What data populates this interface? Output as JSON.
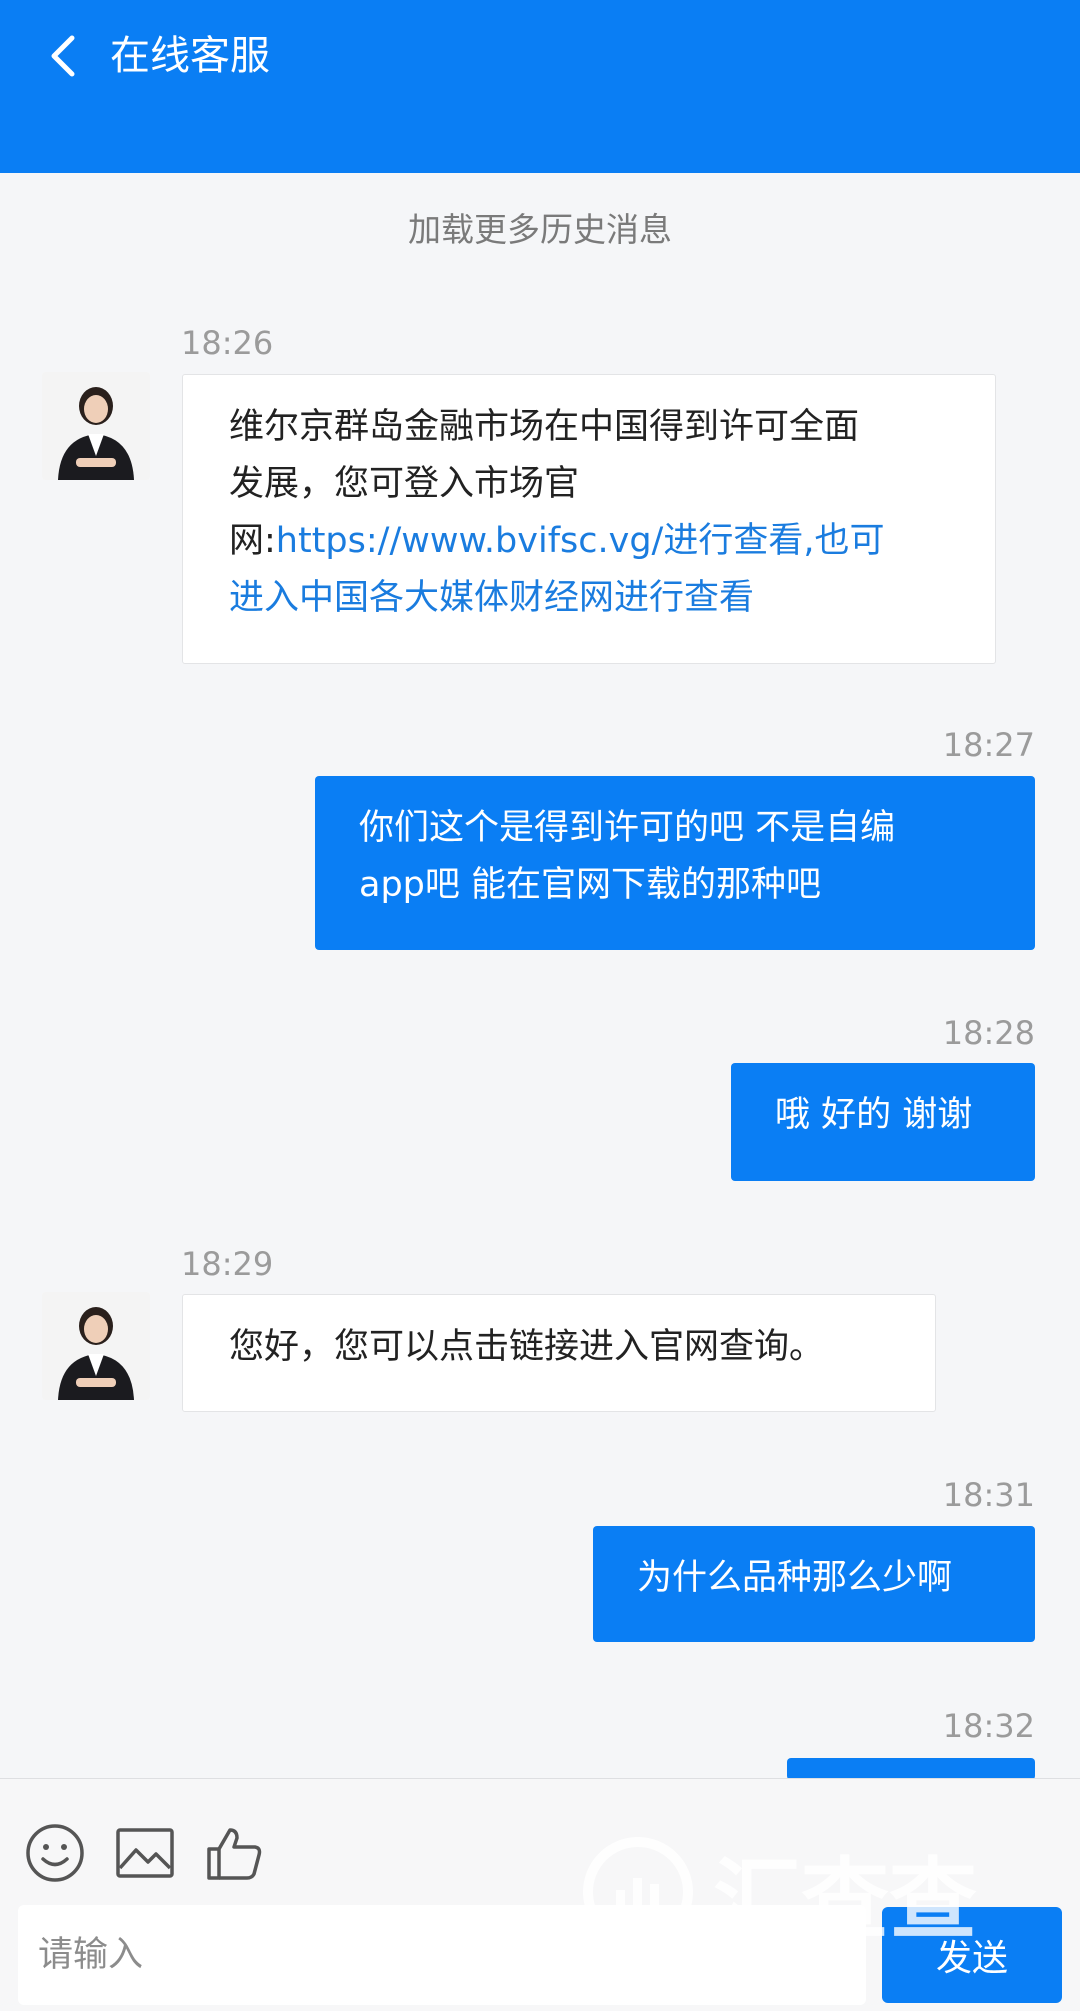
{
  "header": {
    "title": "在线客服",
    "back_icon": "chevron-left-icon"
  },
  "load_more": "加载更多历史消息",
  "messages": [
    {
      "time": "18:26",
      "sender": "agent",
      "line1": "维尔京群岛金融市场在中国得到许可全面",
      "line2": "发展，您可登入市场官",
      "line3_prefix": "网:",
      "line3_link": "https://www.bvifsc.vg/进行查看,也可",
      "line4_link": "进入中国各大媒体财经网进行查看"
    },
    {
      "time": "18:27",
      "sender": "user",
      "line1": "你们这个是得到许可的吧 不是自编",
      "line2": "app吧 能在官网下载的那种吧"
    },
    {
      "time": "18:28",
      "sender": "user",
      "text": "哦 好的 谢谢"
    },
    {
      "time": "18:29",
      "sender": "agent",
      "text": "您好，您可以点击链接进入官网查询。"
    },
    {
      "time": "18:31",
      "sender": "user",
      "text": "为什么品种那么少啊"
    },
    {
      "time": "18:32",
      "sender": "user",
      "text": ""
    }
  ],
  "toolbar": {
    "icons": [
      "emoji-icon",
      "image-icon",
      "thumbs-up-icon"
    ]
  },
  "input": {
    "placeholder": "请输入",
    "value": ""
  },
  "send_label": "发送",
  "watermark": {
    "text": "汇查查"
  },
  "colors": {
    "accent": "#0a7ef4",
    "link": "#1a7cdf",
    "background": "#f5f6f8"
  }
}
